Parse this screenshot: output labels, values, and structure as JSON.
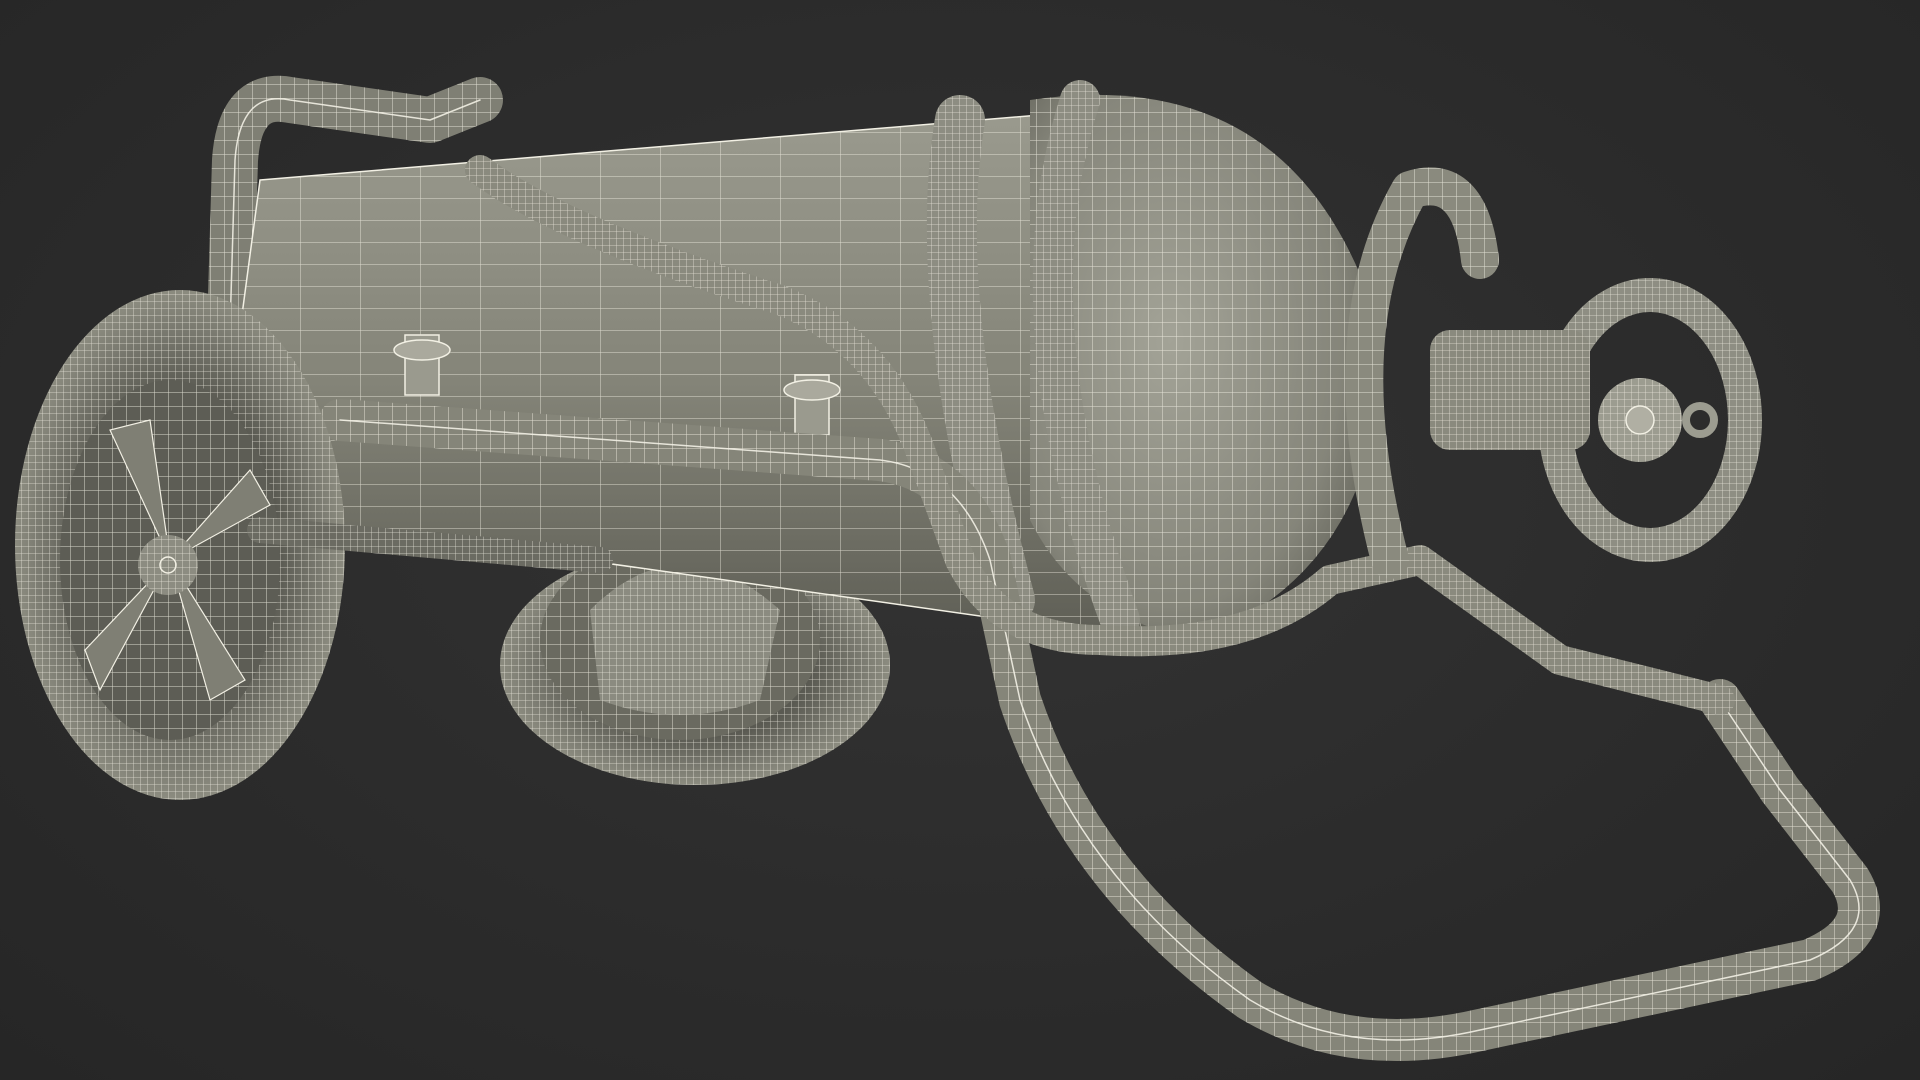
{
  "scene": {
    "subject": "wireframe-3d-model",
    "colors": {
      "background": "#2b2b2b",
      "surface": "#8a8a7e",
      "surface_dark": "#5f5f56",
      "wire": "#f2f0e4"
    }
  }
}
